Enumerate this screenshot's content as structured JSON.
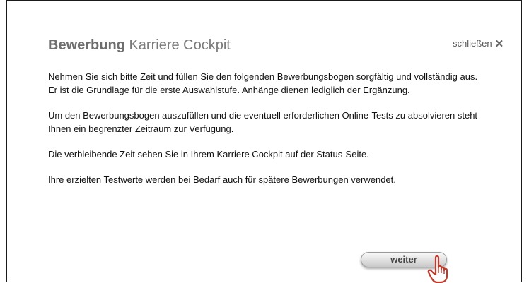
{
  "dialog": {
    "title_bold": "Bewerbung",
    "title_rest": " Karriere Cockpit",
    "close_label": "schließen",
    "close_icon": "close-x-icon",
    "paragraphs": [
      "Nehmen Sie sich bitte Zeit und füllen Sie den folgenden Bewerbungsbogen sorgfältig und vollständig aus. Er ist die Grundlage für die erste Auswahlstufe. Anhänge dienen lediglich der Ergänzung.",
      "Um den Bewerbungsbogen auszufüllen und die eventuell erforderlichen Online-Tests zu absolvieren steht Ihnen ein begrenzter Zeitraum zur Verfügung.",
      "Die verbleibende Zeit sehen Sie in Ihrem Karriere Cockpit auf der Status-Seite.",
      "Ihre erzielten Testwerte werden bei Bedarf auch für spätere Bewerbungen verwendet."
    ],
    "next_button_label": "weiter",
    "cursor_icon": "hand-pointer-icon",
    "colors": {
      "title": "#7a7a7a",
      "text": "#111111",
      "hand_outline": "#c0392b"
    }
  }
}
